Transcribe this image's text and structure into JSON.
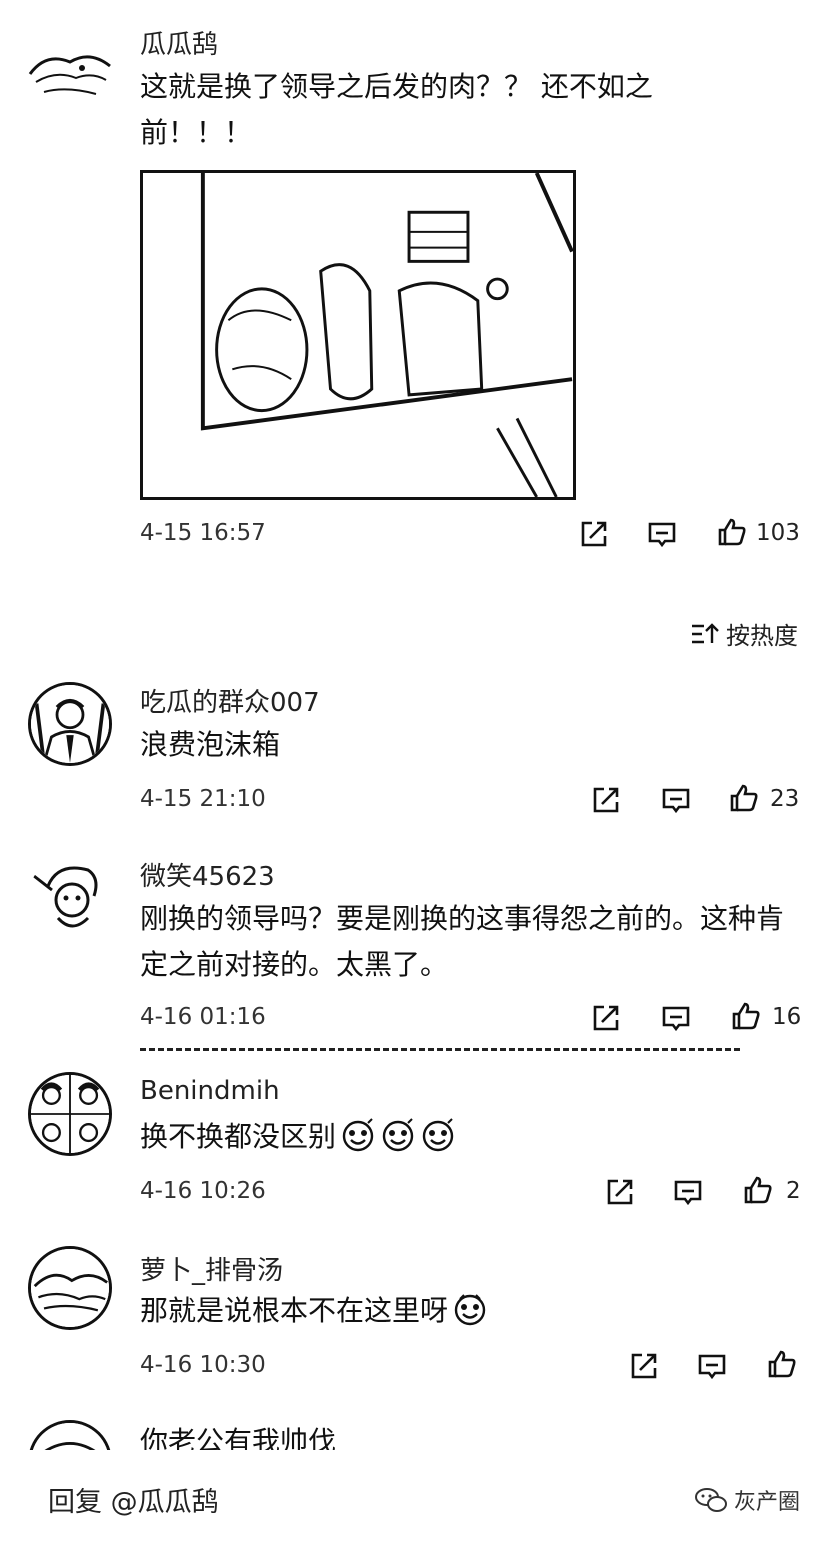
{
  "post": {
    "author": "瓜瓜鸹",
    "text": "这就是换了领导之后发的肉？？  还不如之前！！！",
    "time": "4-15 16:57",
    "likes": "103"
  },
  "sort": {
    "label": "按热度",
    "icon": "sort-icon"
  },
  "comments": [
    {
      "name": "吃瓜的群众007",
      "text": "浪费泡沫箱",
      "time": "4-15 21:10",
      "likes": "23"
    },
    {
      "name": "微笑45623",
      "text": "刚换的领导吗？要是刚换的这事得怨之前的。这种肯定之前对接的。太黑了。",
      "time": "4-16 01:16",
      "likes": "16"
    },
    {
      "name": "Benindmih",
      "text": "换不换都没区别",
      "emoji_count": 3,
      "time": "4-16 10:26",
      "likes": "2"
    },
    {
      "name": "萝卜_排骨汤",
      "text": "那就是说根本不在这里呀",
      "emoji_count": 1,
      "time": "4-16 10:30",
      "likes": ""
    },
    {
      "name": "你老公有我帅伐"
    }
  ],
  "reply": {
    "label": "回复 @瓜瓜鸹"
  },
  "watermark": {
    "text": "灰产圈",
    "icon": "wechat-icon"
  },
  "icons": {
    "share": "share-icon",
    "comment": "comment-icon",
    "like": "thumbs-up-icon"
  }
}
